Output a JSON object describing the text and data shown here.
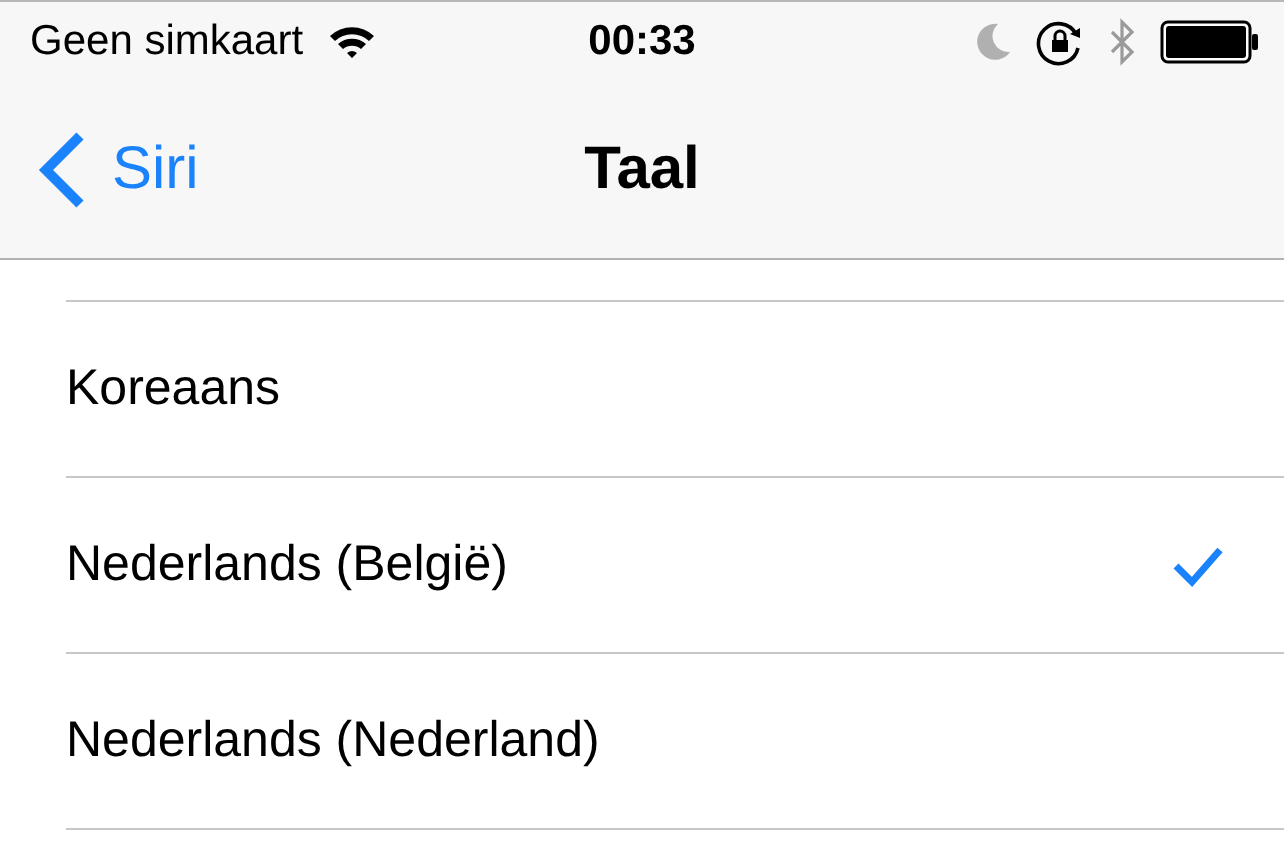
{
  "status_bar": {
    "carrier": "Geen simkaart",
    "time": "00:33"
  },
  "nav_bar": {
    "back": "Siri",
    "title": "Taal"
  },
  "languages": [
    {
      "label": "Koreaans",
      "selected": false
    },
    {
      "label": "Nederlands (België)",
      "selected": true
    },
    {
      "label": "Nederlands (Nederland)",
      "selected": false
    }
  ]
}
